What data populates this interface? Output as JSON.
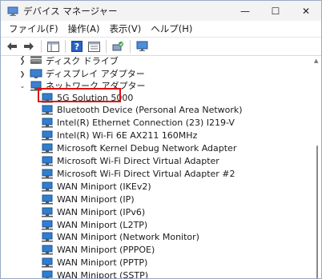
{
  "window": {
    "title": "デバイス マネージャー"
  },
  "controls": {
    "minimize": "—",
    "maximize": "☐",
    "close": "✕"
  },
  "menu": [
    "ファイル(F)",
    "操作(A)",
    "表示(V)",
    "ヘルプ(H)"
  ],
  "tree": {
    "partial_top": "",
    "categories": [
      {
        "label": "ディスク ドライブ",
        "expanded": false,
        "icon": "disk-drive-icon"
      },
      {
        "label": "ディスプレイ アダプター",
        "expanded": false,
        "icon": "display-adapter-icon"
      },
      {
        "label": "ネットワーク アダプター",
        "expanded": true,
        "icon": "network-adapter-icon"
      }
    ],
    "network_adapters": [
      "5G Solution 5000",
      "Bluetooth Device (Personal Area Network)",
      "Intel(R) Ethernet Connection (23) I219-V",
      "Intel(R) Wi-Fi 6E AX211 160MHz",
      "Microsoft Kernel Debug Network Adapter",
      "Microsoft Wi-Fi Direct Virtual Adapter",
      "Microsoft Wi-Fi Direct Virtual Adapter #2",
      "WAN Miniport (IKEv2)",
      "WAN Miniport (IP)",
      "WAN Miniport (IPv6)",
      "WAN Miniport (L2TP)",
      "WAN Miniport (Network Monitor)",
      "WAN Miniport (PPPOE)",
      "WAN Miniport (PPTP)",
      "WAN Miniport (SSTP)"
    ],
    "highlighted": "5G Solution 5000"
  },
  "colors": {
    "highlight_border": "#e01010",
    "network_icon": "#2f7fd1"
  }
}
